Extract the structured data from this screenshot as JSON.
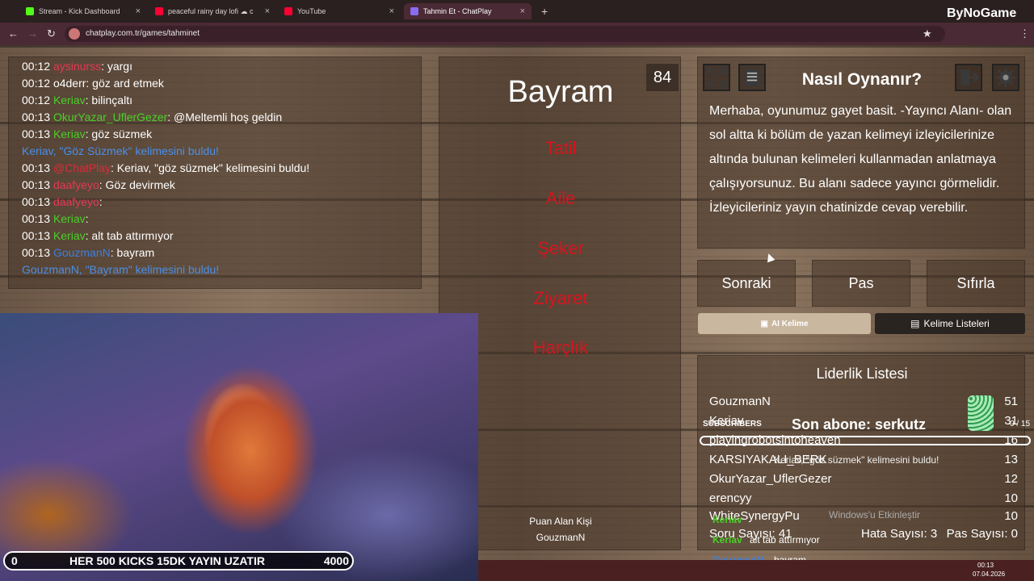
{
  "browser": {
    "tabs": [
      {
        "label": "Stream - Kick Dashboard",
        "color": "#53fc18"
      },
      {
        "label": "peaceful rainy day lofi ☁ c",
        "color": "#ff0033"
      },
      {
        "label": "YouTube",
        "color": "#ff0033"
      },
      {
        "label": "Tahmin Et - ChatPlay",
        "color": "#8a6cf0"
      }
    ],
    "url": "chatplay.com.tr/games/tahminet",
    "brand": "ByNoGame"
  },
  "chat": {
    "lines": [
      {
        "time": "00:12",
        "user": "aysinurss",
        "msg": ": yargı",
        "ucolor": "u-pink"
      },
      {
        "time": "00:12",
        "user": "o4derr",
        "msg": ": göz ard etmek",
        "ucolor": "t"
      },
      {
        "time": "00:12",
        "user": "Keriav",
        "msg": ": bilinçaltı",
        "ucolor": "u-green"
      },
      {
        "time": "00:13",
        "user": "OkurYazar_UflerGezer",
        "msg": ": @Meltemli hoş geldin",
        "ucolor": "u-green"
      },
      {
        "time": "00:13",
        "user": "Keriav",
        "msg": ": göz süzmek",
        "ucolor": "u-green"
      },
      {
        "time": "",
        "user": "Keriav, \"Göz Süzmek\" kelimesini buldu!",
        "msg": "",
        "ucolor": "sys-blue"
      },
      {
        "time": "00:13",
        "user": "@ChatPlay",
        "msg": ": Keriav, \"göz süzmek\" kelimesini buldu!",
        "ucolor": "u-red"
      },
      {
        "time": "00:13",
        "user": "daafyeyo",
        "msg": ": Göz devirmek",
        "ucolor": "u-pink"
      },
      {
        "time": "00:13",
        "user": "daafyeyo",
        "msg": ": ",
        "ucolor": "u-pink"
      },
      {
        "time": "00:13",
        "user": "Keriav",
        "msg": ": ",
        "ucolor": "u-green"
      },
      {
        "time": "00:13",
        "user": "Keriav",
        "msg": ": alt tab attırmıyor",
        "ucolor": "u-green"
      },
      {
        "time": "00:13",
        "user": "GouzmanN",
        "msg": ": bayram",
        "ucolor": "u-blue"
      },
      {
        "time": "",
        "user": "GouzmanN, \"Bayram\" kelimesini buldu!",
        "msg": "",
        "ucolor": "sys-blue"
      }
    ]
  },
  "game": {
    "word": "Bayram",
    "timer": "84",
    "forbidden": [
      "Tatil",
      "Aile",
      "Şeker",
      "Ziyaret",
      "Harçlık"
    ],
    "point_label": "Puan Alan Kişi",
    "point_user": "GouzmanN"
  },
  "howto": {
    "title": "Nasıl Oynanır?",
    "text": "Merhaba, oyunumuz gayet basit. -Yayıncı Alanı- olan sol altta ki bölüm de yazan kelimeyi izleyicilerinize altında bulunan kelimeleri kullanmadan anlatmaya çalışıyorsunuz. Bu alanı sadece yayıncı görmelidir. İzleyicileriniz yayın chatinizde cevap verebilir."
  },
  "controls": {
    "next": "Sonraki",
    "pass": "Pas",
    "reset": "Sıfırla",
    "ai": "AI Kelime",
    "lists": "Kelime Listeleri"
  },
  "leaderboard": {
    "title": "Liderlik Listesi",
    "rows": [
      {
        "name": "GouzmanN",
        "score": "51"
      },
      {
        "name": "Keriav",
        "score": "31"
      },
      {
        "name": "playingrobotsintoheaven",
        "score": "16"
      },
      {
        "name": "KARSIYAKALI_BERK",
        "score": "13"
      },
      {
        "name": "OkurYazar_UflerGezer",
        "score": "12"
      },
      {
        "name": "erencyy",
        "score": "10"
      },
      {
        "name": "WhiteSynergyPu",
        "score": "10"
      }
    ],
    "questions": "Soru Sayısı: 41",
    "errors": "Hata Sayısı: 3",
    "passes": "Pas Sayısı: 0"
  },
  "stream": {
    "kick_left": "0",
    "kick_text": "HER 500 KICKS 15DK YAYIN UZATIR",
    "kick_right": "4000",
    "subscribers_label": "SUBSCRIBERS",
    "sub_count": "0 / 15",
    "last_sub": "Son abone: serkutz",
    "overlay_found": "Keriav, \"göz süzmek\" kelimesini buldu!",
    "overlay_user1": "Keriav",
    "overlay_msg1": "alt tab attırmıyor",
    "overlay_user2": "GouzmanN",
    "overlay_msg2": "bayram",
    "windows_activate": "Windows'u Etkinleştir",
    "clock": "00:13",
    "date": "07.04.2026"
  }
}
